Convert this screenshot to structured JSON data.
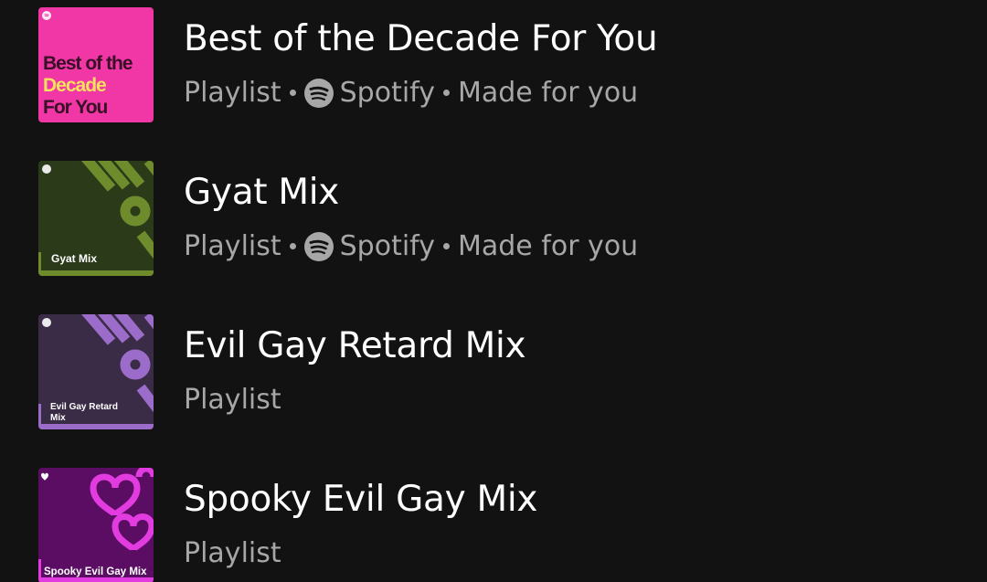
{
  "items": [
    {
      "title": "Best of the Decade For You",
      "type": "Playlist",
      "owner": "Spotify",
      "note": "Made for you",
      "cover_lines": [
        "Best of the",
        "Decade",
        "For You"
      ],
      "cover_color": "#f037a5",
      "cover_accent": "#f6e05e"
    },
    {
      "title": "Gyat Mix",
      "type": "Playlist",
      "owner": "Spotify",
      "note": "Made for you",
      "cover_label": "Gyat Mix",
      "cover_color": "#2b3b1a",
      "cover_accent": "#6f8c2c"
    },
    {
      "title": "Evil Gay Retard Mix",
      "type": "Playlist",
      "cover_label_1": "Evil Gay Retard",
      "cover_label_2": "Mix",
      "cover_color": "#3a2c47",
      "cover_accent": "#9b6cc9"
    },
    {
      "title": "Spooky Evil Gay Mix",
      "type": "Playlist",
      "cover_label": "Spooky Evil Gay Mix",
      "cover_color": "#5a0d63",
      "cover_accent": "#e23be0"
    }
  ],
  "icons": {
    "spotify": "spotify-logo-icon"
  }
}
